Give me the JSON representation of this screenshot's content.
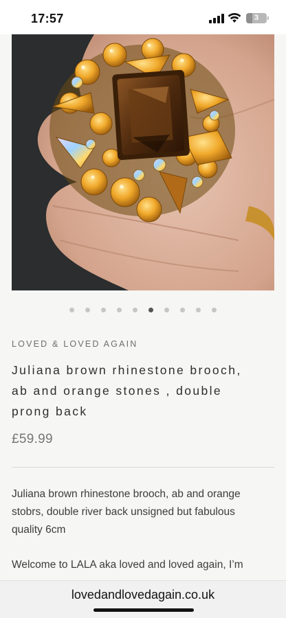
{
  "status_bar": {
    "time": "17:57",
    "battery_label": "3",
    "battery_level": 0.3,
    "icons": [
      "signal-icon",
      "wifi-icon",
      "battery-icon"
    ]
  },
  "product": {
    "image_alt": "Juliana brown rhinestone brooch held in hand",
    "carousel": {
      "count": 10,
      "active_index": 5
    },
    "vendor": "LOVED & LOVED AGAIN",
    "title_lines": [
      "Juliana brown rhinestone brooch,",
      "ab and orange stones , double",
      "prong back"
    ],
    "price": "£59.99",
    "description_lines": [
      "Juliana brown rhinestone brooch, ab and orange",
      "stobrs, double river back unsigned but fabulous",
      "quality 6cm"
    ],
    "description_2": "Welcome to LALA aka loved and loved again, I’m"
  },
  "browser": {
    "url": "lovedandlovedagain.co.uk"
  },
  "colors": {
    "page_bg": "#f6f6f5",
    "amber": "#e8a32a",
    "topaz": "#5a3312",
    "dark_bg": "#2b2d2e"
  }
}
